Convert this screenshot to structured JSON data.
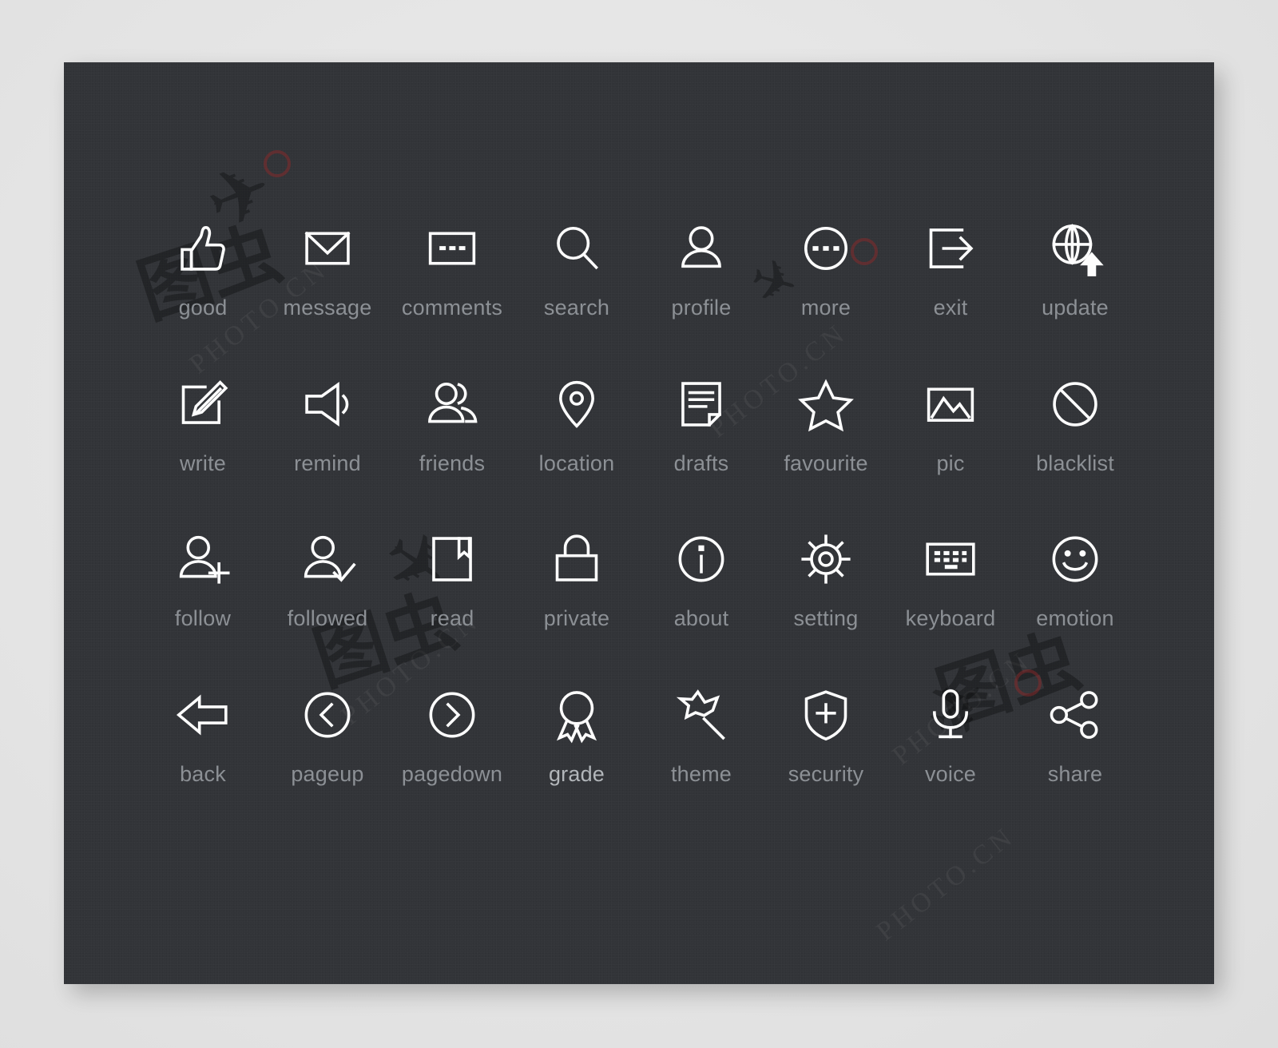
{
  "panel": {
    "background_color": "#323438",
    "page_background_color": "#e6e6e6",
    "icon_color": "#fdfdfd",
    "label_color": "#8c9095"
  },
  "watermarks": [
    {
      "text": "PHOTO.CN"
    },
    {
      "text": "PHOTO.CN"
    },
    {
      "text": "PHOTO.CN"
    },
    {
      "text": "PHOTO.CN"
    },
    {
      "text": "PHOTO.CN"
    }
  ],
  "icon_set": {
    "columns": 8,
    "rows": 4,
    "count": 32,
    "icons": [
      {
        "id": "good",
        "label": "good",
        "icon": "thumbs-up-icon"
      },
      {
        "id": "message",
        "label": "message",
        "icon": "envelope-icon"
      },
      {
        "id": "comments",
        "label": "comments",
        "icon": "comment-box-icon"
      },
      {
        "id": "search",
        "label": "search",
        "icon": "magnifier-icon"
      },
      {
        "id": "profile",
        "label": "profile",
        "icon": "user-icon"
      },
      {
        "id": "more",
        "label": "more",
        "icon": "ellipsis-circle-icon"
      },
      {
        "id": "exit",
        "label": "exit",
        "icon": "exit-arrow-icon"
      },
      {
        "id": "update",
        "label": "update",
        "icon": "globe-upload-icon"
      },
      {
        "id": "write",
        "label": "write",
        "icon": "pencil-square-icon"
      },
      {
        "id": "remind",
        "label": "remind",
        "icon": "speaker-icon"
      },
      {
        "id": "friends",
        "label": "friends",
        "icon": "users-icon"
      },
      {
        "id": "location",
        "label": "location",
        "icon": "map-pin-icon"
      },
      {
        "id": "drafts",
        "label": "drafts",
        "icon": "document-lines-icon"
      },
      {
        "id": "favourite",
        "label": "favourite",
        "icon": "star-icon"
      },
      {
        "id": "pic",
        "label": "pic",
        "icon": "image-icon"
      },
      {
        "id": "blacklist",
        "label": "blacklist",
        "icon": "no-entry-icon"
      },
      {
        "id": "follow",
        "label": "follow",
        "icon": "user-plus-icon"
      },
      {
        "id": "followed",
        "label": "followed",
        "icon": "user-check-icon"
      },
      {
        "id": "read",
        "label": "read",
        "icon": "book-bookmark-icon"
      },
      {
        "id": "private",
        "label": "private",
        "icon": "lock-icon"
      },
      {
        "id": "about",
        "label": "about",
        "icon": "info-circle-icon"
      },
      {
        "id": "setting",
        "label": "setting",
        "icon": "gear-icon"
      },
      {
        "id": "keyboard",
        "label": "keyboard",
        "icon": "keyboard-icon"
      },
      {
        "id": "emotion",
        "label": "emotion",
        "icon": "smiley-icon"
      },
      {
        "id": "back",
        "label": "back",
        "icon": "back-arrow-icon"
      },
      {
        "id": "pageup",
        "label": "pageup",
        "icon": "chevron-left-circle-icon"
      },
      {
        "id": "pagedown",
        "label": "pagedown",
        "icon": "chevron-right-circle-icon"
      },
      {
        "id": "grade",
        "label": "grade",
        "icon": "award-ribbon-icon"
      },
      {
        "id": "theme",
        "label": "theme",
        "icon": "magic-wand-star-icon"
      },
      {
        "id": "security",
        "label": "security",
        "icon": "shield-plus-icon"
      },
      {
        "id": "voice",
        "label": "voice",
        "icon": "microphone-icon"
      },
      {
        "id": "share",
        "label": "share",
        "icon": "share-nodes-icon"
      }
    ]
  }
}
